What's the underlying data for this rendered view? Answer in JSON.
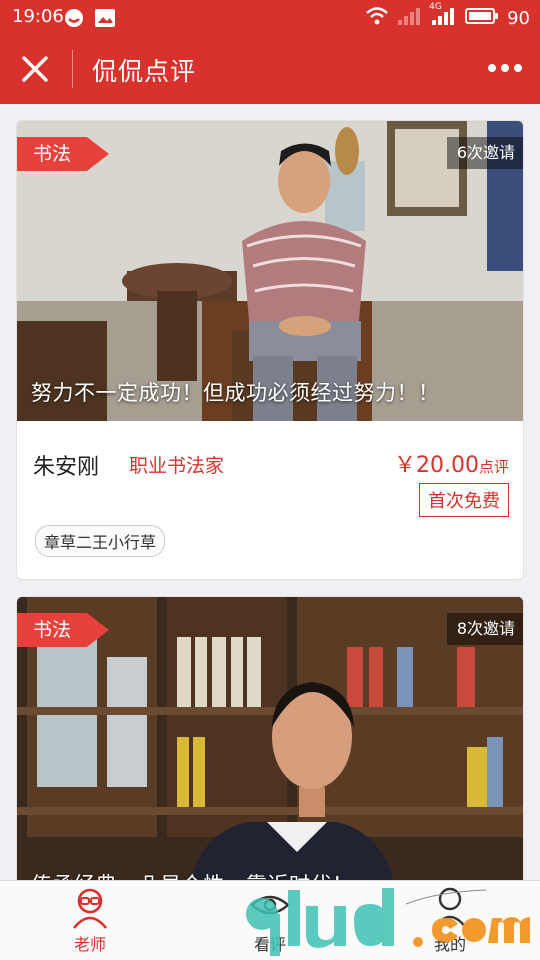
{
  "status_bar": {
    "time": "19:06",
    "battery": "90",
    "network": "4G"
  },
  "header": {
    "title": "侃侃点评"
  },
  "cards": [
    {
      "category": "书法",
      "invites": "6次邀请",
      "motto": "努力不一定成功！但成功必须经过努力！！",
      "name": "朱安刚",
      "role": "职业书法家",
      "price": "￥20.00",
      "price_unit": "点评",
      "badge": "首次免费",
      "skills": [
        "章草二王小行草"
      ]
    },
    {
      "category": "书法",
      "invites": "8次邀请",
      "motto": "传承经典，凸显个性，靠近时代！"
    }
  ],
  "nav": {
    "items": [
      {
        "label": "老师",
        "icon": "teacher-icon",
        "active": true
      },
      {
        "label": "看评",
        "icon": "eye-icon",
        "active": false
      },
      {
        "label": "我的",
        "icon": "user-icon",
        "active": false
      }
    ]
  },
  "colors": {
    "brand": "#d9322c",
    "tag": "#e8403a"
  }
}
